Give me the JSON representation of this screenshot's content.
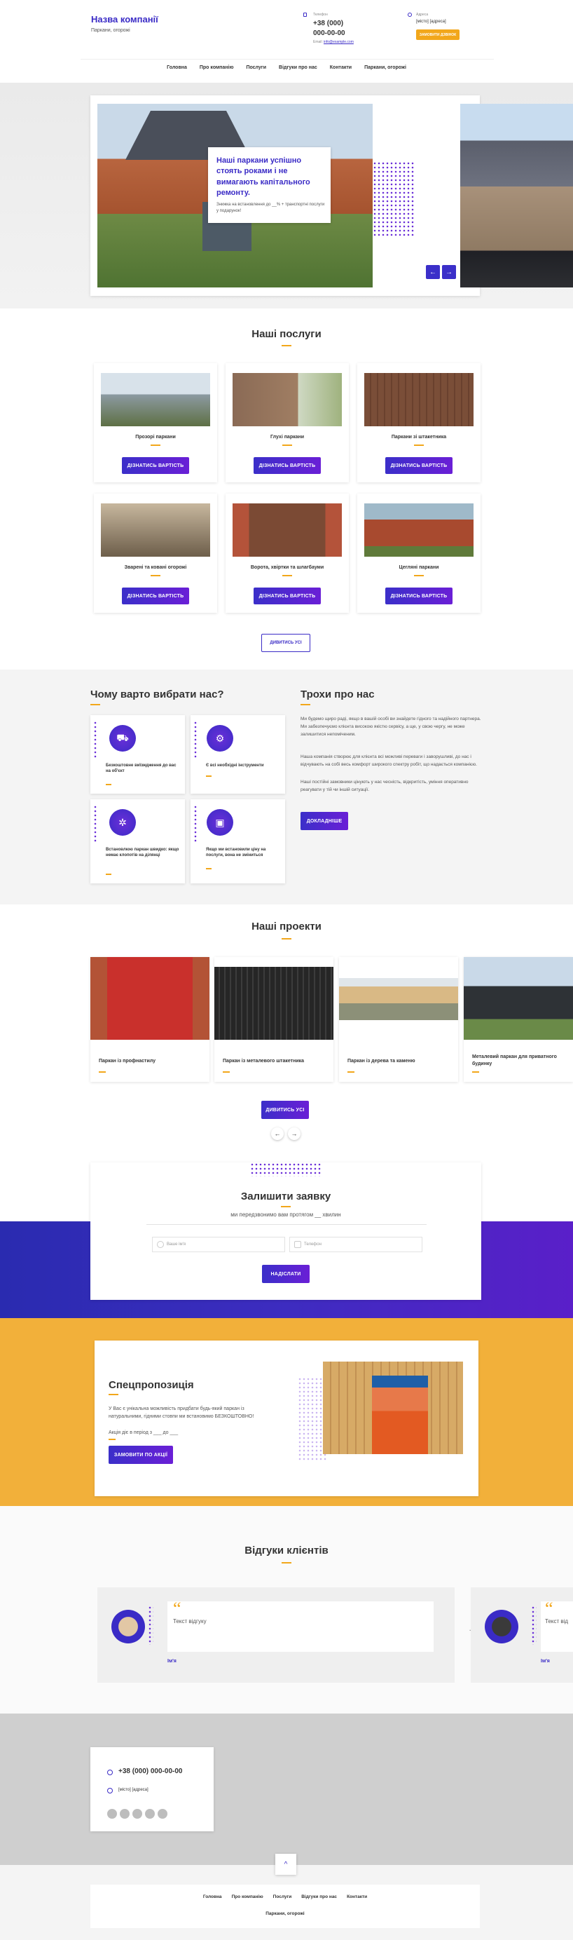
{
  "header": {
    "company": "Назва компанії",
    "tagline": "Паркани, огорожі",
    "phone_label": "Телефон",
    "phone1": "+38 (000)",
    "phone2": "000-00-00",
    "email_label": "Email:",
    "email": "info@example.com",
    "address_label": "Адреса",
    "address": "[місто] [адреса]",
    "cta": "ЗАМОВИТИ ДЗВІНОК"
  },
  "nav": [
    "Головна",
    "Про компанію",
    "Послуги",
    "Відгуки про нас",
    "Контакти",
    "Паркани, огорожі"
  ],
  "hero": {
    "title": "Наші паркани успішно стоять роками і не вимагають капітального ремонту.",
    "text": "Знижка на встановлення до __% + транспортні послуги у подарунок!",
    "prev": "←",
    "next": "→"
  },
  "services": {
    "title": "Наші послуги",
    "btn": "ДІЗНАТИСЬ ВАРТІСТЬ",
    "items": [
      "Прозорі паркани",
      "Глухі паркани",
      "Паркани зі штакетника",
      "Зварені та ковані огорожі",
      "Ворота, хвіртки та шлагбауми",
      "Цегляні паркани"
    ],
    "more": "ДИВИТИСЬ УСІ"
  },
  "why": {
    "title": "Чому варто вибрати нас?",
    "items": [
      "Безкоштовне виїзждження до вас на об'єкт",
      "Є всі необхідні інструменти",
      "Встановлюю паркан швидко: якщо немає клопотів на ділянці",
      "Якщо ми встановили ціну на послуги, вона не зміниться"
    ]
  },
  "about": {
    "title": "Трохи про нас",
    "p1": "Ми будемо щиро раді, якщо в вашій особі ви знайдете гідного та надійного партнера. Ми забезпечуємо клієнта високою якістю сервісу, а ще, у свою чергу, не може залишитися непоміченим.",
    "p2": "Наша компанія створює для клієнта всі можливі переваги і заворушливі, до нас і відчувають на собі весь комфорт широкого спектру робіт, що надається компанією.",
    "p3": "Наші постійні замовники цінують у нас чесність, відкритість, уміння оперативно реагувати у тій чи іншій ситуації.",
    "btn": "ДОКЛАДНІШЕ"
  },
  "projects": {
    "title": "Наші проекти",
    "items": [
      "Паркан із профнастилу",
      "Паркан із металевого штакетника",
      "Паркан із дерева та каменю",
      "Металевий паркан для приватного будинку"
    ],
    "btn": "ДИВИТИСЬ УСІ",
    "prev": "←",
    "next": "→"
  },
  "request": {
    "title": "Залишити заявку",
    "subtitle": "ми передзвонимо вам протягом __ хвилин",
    "name_ph": "Ваше ім'я",
    "phone_ph": "Телефон",
    "btn": "НАДІСЛАТИ"
  },
  "special": {
    "title": "Спецпропозиція",
    "text": "У Вас є унікальна можливість придбати будь-який паркан із натуральними, гідними стовпи ми встановимо БЕЗКОШТОВНО!",
    "date": "Акція діє в період з ___ до ___",
    "btn": "ЗАМОВИТИ ПО АКЦІЇ"
  },
  "reviews": {
    "title": "Відгуки клієнтів",
    "text": "Текст відгуку",
    "text2": "Текст від",
    "name": "Ім'я",
    "quote": "“"
  },
  "contacts": {
    "phone": "+38 (000) 000-00-00",
    "address": "[місто] [адреса]"
  },
  "footer": {
    "nav": [
      "Головна",
      "Про компанію",
      "Послуги",
      "Відгуки про нас",
      "Контакти"
    ],
    "nav2": "Паркани, огорожі",
    "up": "^"
  }
}
